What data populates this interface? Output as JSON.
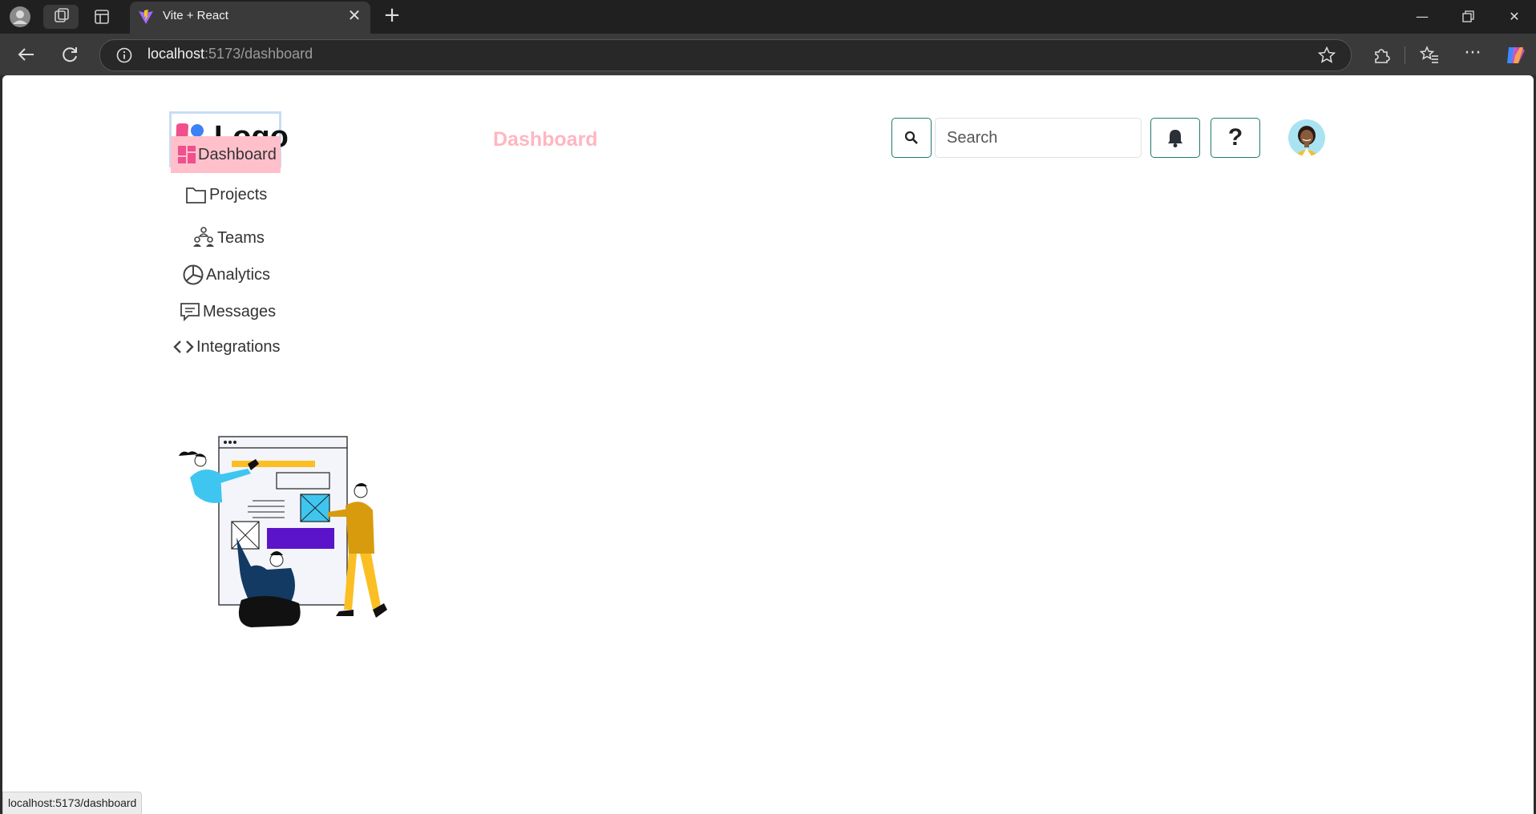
{
  "browser": {
    "tab_title": "Vite + React",
    "url_host": "localhost",
    "url_path": ":5173/dashboard",
    "status_url": "localhost:5173/dashboard"
  },
  "app": {
    "logo_text": "Logo",
    "header_title": "Dashboard",
    "search_placeholder": "Search",
    "help_label": "?",
    "nav": [
      {
        "label": "Dashboard",
        "icon": "dashboard-icon",
        "active": true
      },
      {
        "label": "Projects",
        "icon": "folder-icon",
        "active": false
      },
      {
        "label": "Teams",
        "icon": "teams-icon",
        "active": false
      },
      {
        "label": "Analytics",
        "icon": "pie-chart-icon",
        "active": false
      },
      {
        "label": "Messages",
        "icon": "message-icon",
        "active": false
      },
      {
        "label": "Integrations",
        "icon": "code-icon",
        "active": false
      }
    ]
  },
  "colors": {
    "accent_pink": "#ffc0cb",
    "header_title_pink": "#ffb6c1",
    "button_border_teal": "#1f7a6a"
  }
}
